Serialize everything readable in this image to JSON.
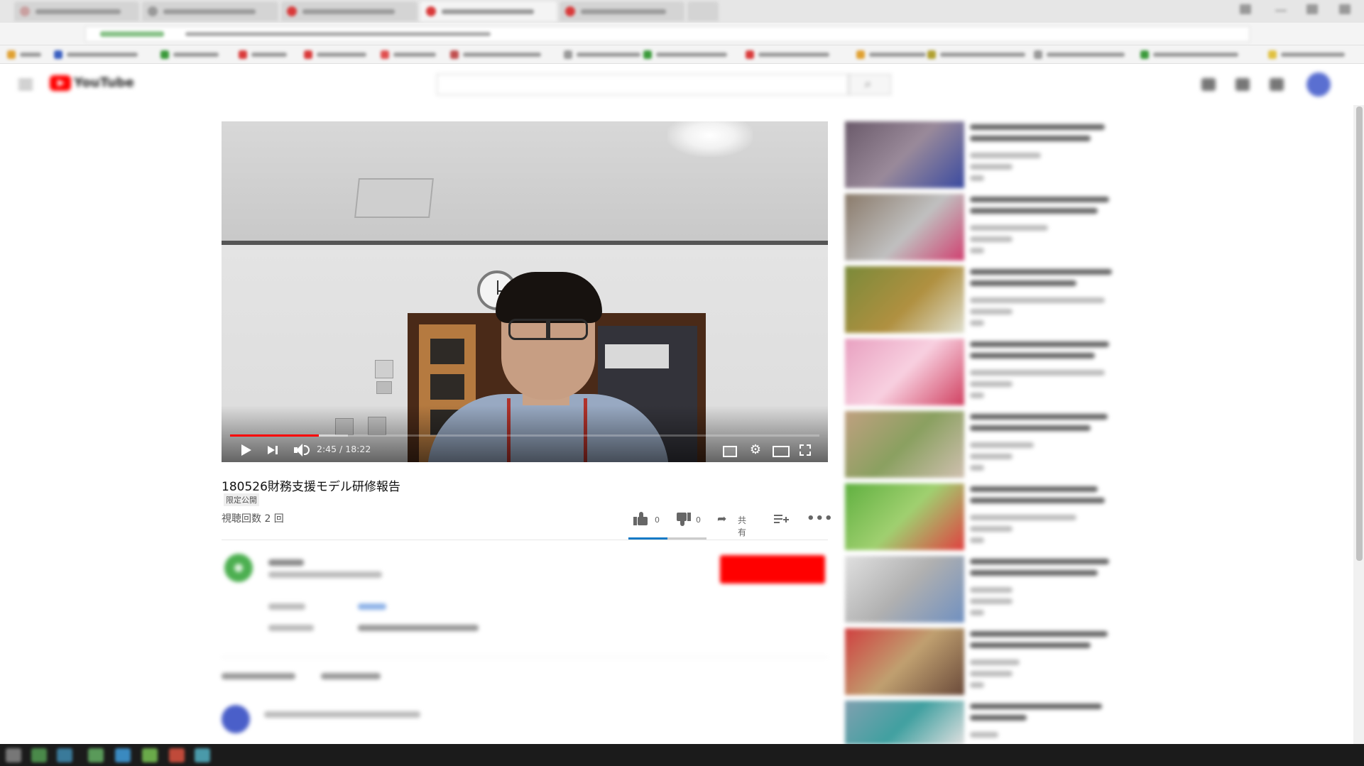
{
  "video": {
    "title": "180526財務支援モデル研修報告",
    "privacy_badge": "限定公開",
    "views": "視聴回数 2 回",
    "time_current": "2:45",
    "time_separator": " / ",
    "time_total": "18:22",
    "progress_fraction": 0.15,
    "buffered_fraction": 0.2
  },
  "actions": {
    "like_count": "0",
    "dislike_count": "0",
    "share_label": "共有"
  },
  "colors": {
    "brand_red": "#ff0000",
    "accent_blue": "#167ac6",
    "text_dark": "#111111",
    "text_muted": "#555555"
  },
  "icons": [
    "play-icon",
    "next-icon",
    "volume-icon",
    "subtitles-icon",
    "gear-icon",
    "theater-mode-icon",
    "fullscreen-icon",
    "thumbs-up-icon",
    "thumbs-down-icon",
    "share-icon",
    "add-to-playlist-icon",
    "more-icon",
    "hamburger-menu-icon",
    "youtube-logo-icon",
    "search-icon"
  ]
}
